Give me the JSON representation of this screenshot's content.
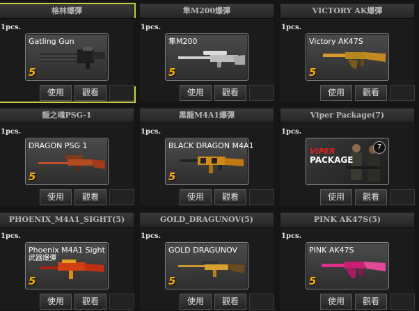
{
  "items": [
    {
      "title": "格林爆彈",
      "qty": "1pcs.",
      "name": "Gatling Gun",
      "sub": "",
      "level": "5",
      "weapon": "gatling-icon",
      "use": "使用",
      "view": "觀看"
    },
    {
      "title": "隼M200爆彈",
      "qty": "1pcs.",
      "name": "隼M200",
      "sub": "",
      "level": "5",
      "weapon": "sniper-icon",
      "use": "使用",
      "view": "觀看"
    },
    {
      "title": "VICTORY AK爆彈",
      "qty": "1pcs.",
      "name": "Victory AK47S",
      "sub": "",
      "level": "5",
      "weapon": "ak-gold-icon",
      "use": "使用",
      "view": "觀看"
    },
    {
      "title": "龍之魂PSG-1",
      "qty": "1pcs.",
      "name": "DRAGON PSG 1",
      "sub": "",
      "level": "5",
      "weapon": "psg-icon",
      "use": "使用",
      "view": "觀看"
    },
    {
      "title": "黑龍M4A1爆彈",
      "qty": "1pcs.",
      "name": "BLACK DRAGON M4A1",
      "sub": "",
      "level": "5",
      "weapon": "m4a1-icon",
      "use": "使用",
      "view": "觀看"
    },
    {
      "title": "Viper Package(7)",
      "qty": "1pcs.",
      "name": "",
      "sub": "",
      "level": "",
      "weapon": "viper-package-image",
      "use": "使用",
      "view": "觀看",
      "viper": {
        "line1": "VIPER",
        "line2": "PACKAGE",
        "badge": "7"
      }
    },
    {
      "title": "PHOENIX_M4A1_SIGHT(5)",
      "qty": "1pcs.",
      "name": "Phoenix M4A1 Sight",
      "sub": "武器爆彈",
      "level": "5",
      "weapon": "phoenix-icon",
      "use": "使用",
      "view": "觀看"
    },
    {
      "title": "GOLD_DRAGUNOV(5)",
      "qty": "1pcs.",
      "name": "GOLD DRAGUNOV",
      "sub": "",
      "level": "5",
      "weapon": "dragunov-icon",
      "use": "使用",
      "view": "觀看"
    },
    {
      "title": "PINK AK47S(5)",
      "qty": "1pcs.",
      "name": "PINK AK47S",
      "sub": "",
      "level": "5",
      "weapon": "ak-pink-icon",
      "use": "使用",
      "view": "觀看"
    }
  ],
  "colors": {
    "accent": "#c8d23a",
    "level": "#ffb000",
    "gold": "#e0a020",
    "pink": "#e0308a",
    "dark": "#2a2a2a"
  }
}
